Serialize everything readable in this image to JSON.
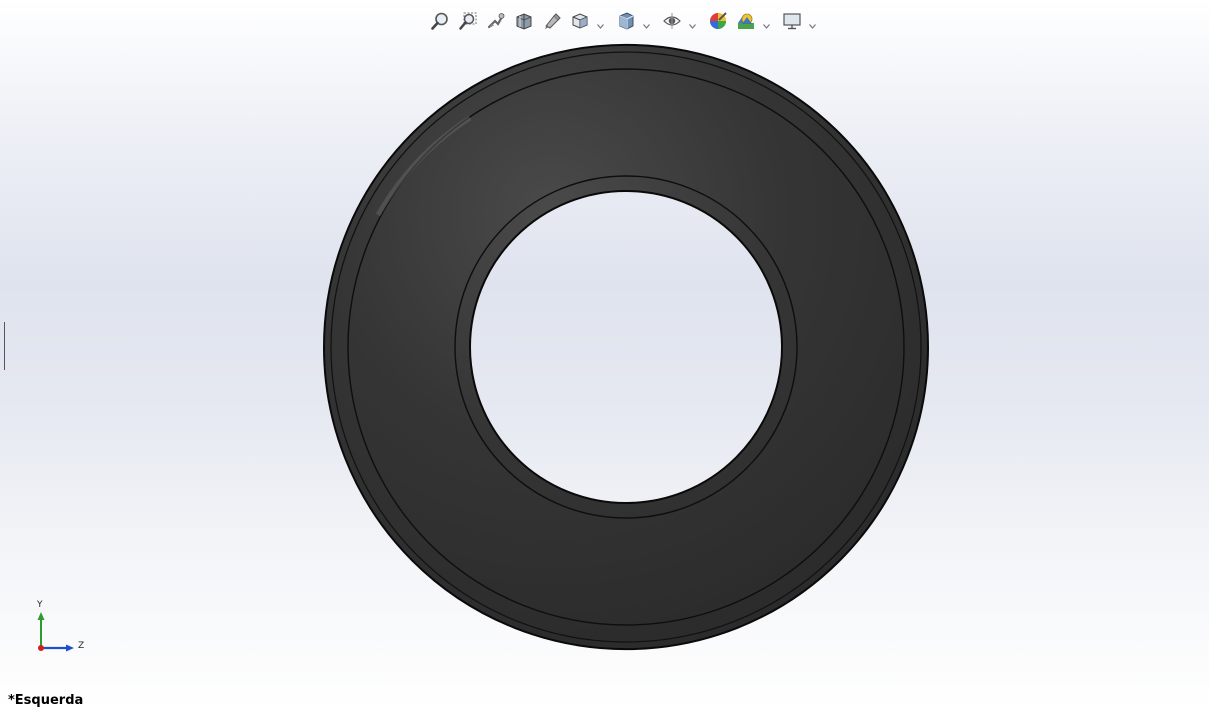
{
  "window": {
    "title": ""
  },
  "toolbar": {
    "items": [
      {
        "name": "zoom-to-fit-icon",
        "dropdown": false
      },
      {
        "name": "zoom-to-area-icon",
        "dropdown": false
      },
      {
        "name": "previous-view-icon",
        "dropdown": false
      },
      {
        "name": "section-view-icon",
        "dropdown": false
      },
      {
        "name": "dynamic-annotation-icon",
        "dropdown": false
      },
      {
        "name": "view-orientation-icon",
        "dropdown": true
      },
      {
        "name": "display-style-icon",
        "dropdown": true
      },
      {
        "name": "hide-show-items-icon",
        "dropdown": true
      },
      {
        "name": "edit-appearance-icon",
        "dropdown": false
      },
      {
        "name": "apply-scene-icon",
        "dropdown": true
      },
      {
        "name": "view-settings-icon",
        "dropdown": true
      }
    ]
  },
  "model": {
    "shape": "ring",
    "colors": {
      "body": "#343434",
      "edge": "#0a0a0a",
      "highlight": "#5a5a5a"
    }
  },
  "triad": {
    "y_label": "Y",
    "z_label": "Z"
  },
  "view": {
    "label": "*Esquerda"
  },
  "colors": {
    "background_top": "#ffffff",
    "background_mid": "#dfe3ee",
    "axis_y": "#2e9b2e",
    "axis_z": "#1f4fd1",
    "axis_x": "#d11f1f"
  }
}
